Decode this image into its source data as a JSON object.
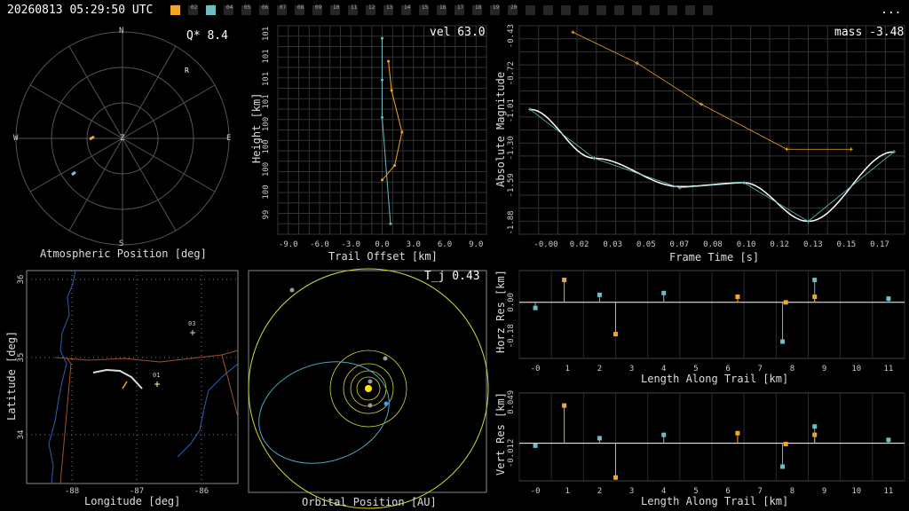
{
  "header": {
    "timestamp": "20260813 05:29:50 UTC",
    "more": "...",
    "stations": [
      {
        "label": "01",
        "state": "active-orange"
      },
      {
        "label": "02",
        "state": "off"
      },
      {
        "label": "03",
        "state": "active-teal"
      },
      {
        "label": "04",
        "state": "off"
      },
      {
        "label": "05",
        "state": "off"
      },
      {
        "label": "06",
        "state": "off"
      },
      {
        "label": "07",
        "state": "off"
      },
      {
        "label": "08",
        "state": "off"
      },
      {
        "label": "09",
        "state": "off"
      },
      {
        "label": "10",
        "state": "off"
      },
      {
        "label": "11",
        "state": "off"
      },
      {
        "label": "12",
        "state": "off"
      },
      {
        "label": "13",
        "state": "off"
      },
      {
        "label": "14",
        "state": "off"
      },
      {
        "label": "15",
        "state": "off"
      },
      {
        "label": "16",
        "state": "off"
      },
      {
        "label": "17",
        "state": "off"
      },
      {
        "label": "18",
        "state": "off"
      },
      {
        "label": "19",
        "state": "off"
      },
      {
        "label": "20",
        "state": "off"
      },
      {
        "label": "",
        "state": "off"
      },
      {
        "label": "",
        "state": "off"
      },
      {
        "label": "",
        "state": "off"
      },
      {
        "label": "",
        "state": "off"
      },
      {
        "label": "",
        "state": "off"
      },
      {
        "label": "",
        "state": "off"
      },
      {
        "label": "",
        "state": "off"
      },
      {
        "label": "",
        "state": "off"
      },
      {
        "label": "",
        "state": "off"
      },
      {
        "label": "",
        "state": "off"
      },
      {
        "label": "",
        "state": "off"
      }
    ]
  },
  "colors": {
    "orange": "#f5a623",
    "teal": "#6bbec2",
    "white": "#ffffff",
    "grid": "#444444",
    "yellow": "#d6d63c",
    "blue": "#3aa0ff"
  },
  "polar": {
    "corner": "Q*  8.4",
    "xlabel": "Atmospheric Position [deg]",
    "north": "N",
    "south": "S",
    "east": "E",
    "west": "W",
    "zenith": "Z",
    "r_marker": "R"
  },
  "trail": {
    "corner": "vel 63.0",
    "xlabel": "Trail Offset [km]",
    "ylabel": "Height [km]",
    "xticks": [
      "-9.0",
      "-6.0",
      "-3.0",
      "0.0",
      "3.0",
      "6.0",
      "9.0"
    ],
    "yticks": [
      "99",
      "100",
      "100",
      "100",
      "100",
      "101",
      "101",
      "101",
      "101"
    ]
  },
  "mag": {
    "corner": "mass -3.48",
    "xlabel": "Frame Time [s]",
    "ylabel": "Absolute Magnitude",
    "xticks": [
      "-0.00",
      "0.02",
      "0.03",
      "0.05",
      "0.07",
      "0.08",
      "0.10",
      "0.12",
      "0.13",
      "0.15",
      "0.17"
    ],
    "yticks": [
      "-1.88",
      "-1.59",
      "-1.30",
      "-1.01",
      "-0.72",
      "-0.43"
    ]
  },
  "map": {
    "xlabel": "Longitude [deg]",
    "ylabel": "Latitude [deg]",
    "xticks": [
      "-88",
      "-87",
      "-86"
    ],
    "yticks": [
      "36",
      "35",
      "34"
    ],
    "station1": "01",
    "station3": "03"
  },
  "orbit": {
    "corner": "T_j 0.43",
    "xlabel": "Orbital Position [AU]"
  },
  "horz": {
    "xlabel": "Length Along Trail [km]",
    "ylabel": "Horz Res [km]",
    "xticks": [
      "-0",
      "1",
      "2",
      "3",
      "4",
      "5",
      "6",
      "7",
      "8",
      "9",
      "10",
      "11"
    ],
    "yticks": [
      "0.00",
      "-0.18"
    ]
  },
  "vert": {
    "xlabel": "Length Along Trail [km]",
    "ylabel": "Vert Res [km]",
    "xticks": [
      "-0",
      "1",
      "2",
      "3",
      "4",
      "5",
      "6",
      "7",
      "8",
      "9",
      "10",
      "11"
    ],
    "yticks": [
      "0.049",
      "-0.012"
    ]
  },
  "chart_data": [
    {
      "type": "line",
      "name": "trail",
      "xlabel": "Trail Offset [km]",
      "ylabel": "Height [km]",
      "xlim": [
        -10,
        10
      ],
      "ylim": [
        0,
        1
      ],
      "series": [
        {
          "color": "orange",
          "x": [
            0.6,
            0.9,
            1.9,
            1.2,
            0.0
          ],
          "y": [
            0.83,
            0.69,
            0.49,
            0.33,
            0.26
          ]
        },
        {
          "color": "teal",
          "x": [
            0.0,
            0.0,
            0.0,
            0.8
          ],
          "y": [
            0.94,
            0.74,
            0.56,
            0.05
          ]
        }
      ]
    },
    {
      "type": "line",
      "name": "magnitude",
      "xlabel": "Frame Time [s]",
      "ylabel": "Absolute Magnitude",
      "xlim": [
        -0.005,
        0.175
      ],
      "ylim": [
        -0.35,
        -1.97
      ],
      "series": [
        {
          "color": "teal",
          "x": [
            -0.0,
            0.03,
            0.07,
            0.1,
            0.13,
            0.17
          ],
          "y": [
            -1.0,
            -1.38,
            -1.61,
            -1.57,
            -1.87,
            -1.33
          ]
        },
        {
          "color": "orange",
          "x": [
            0.02,
            0.05,
            0.08,
            0.12,
            0.15
          ],
          "y": [
            -0.4,
            -0.64,
            -0.96,
            -1.31,
            -1.31
          ]
        }
      ]
    },
    {
      "type": "scatter",
      "name": "horizontal residuals",
      "xlabel": "Length Along Trail [km]",
      "ylabel": "Horz Res [km]",
      "xlim": [
        -0.5,
        11.5
      ],
      "ylim": [
        -0.3,
        0.17
      ],
      "series": [
        {
          "color": "orange",
          "x": [
            0.9,
            2.5,
            6.3,
            7.8,
            8.7
          ],
          "y": [
            0.12,
            -0.17,
            0.03,
            0.0,
            0.03
          ]
        },
        {
          "color": "teal",
          "x": [
            0.0,
            2.0,
            4.0,
            7.7,
            8.7,
            11.0
          ],
          "y": [
            -0.03,
            0.04,
            0.05,
            -0.21,
            0.12,
            0.02
          ]
        }
      ]
    },
    {
      "type": "scatter",
      "name": "vertical residuals",
      "xlabel": "Length Along Trail [km]",
      "ylabel": "Vert Res [km]",
      "xlim": [
        -0.5,
        11.5
      ],
      "ylim": [
        -0.045,
        0.06
      ],
      "series": [
        {
          "color": "orange",
          "x": [
            0.9,
            2.5,
            6.3,
            7.8,
            8.7
          ],
          "y": [
            0.045,
            -0.041,
            0.012,
            -0.001,
            0.01
          ],
          "baseline": 0
        },
        {
          "color": "teal",
          "x": [
            0.0,
            2.0,
            4.0,
            7.7,
            8.7,
            11.0
          ],
          "y": [
            -0.003,
            0.006,
            0.01,
            -0.028,
            0.02,
            0.004
          ]
        }
      ]
    }
  ]
}
